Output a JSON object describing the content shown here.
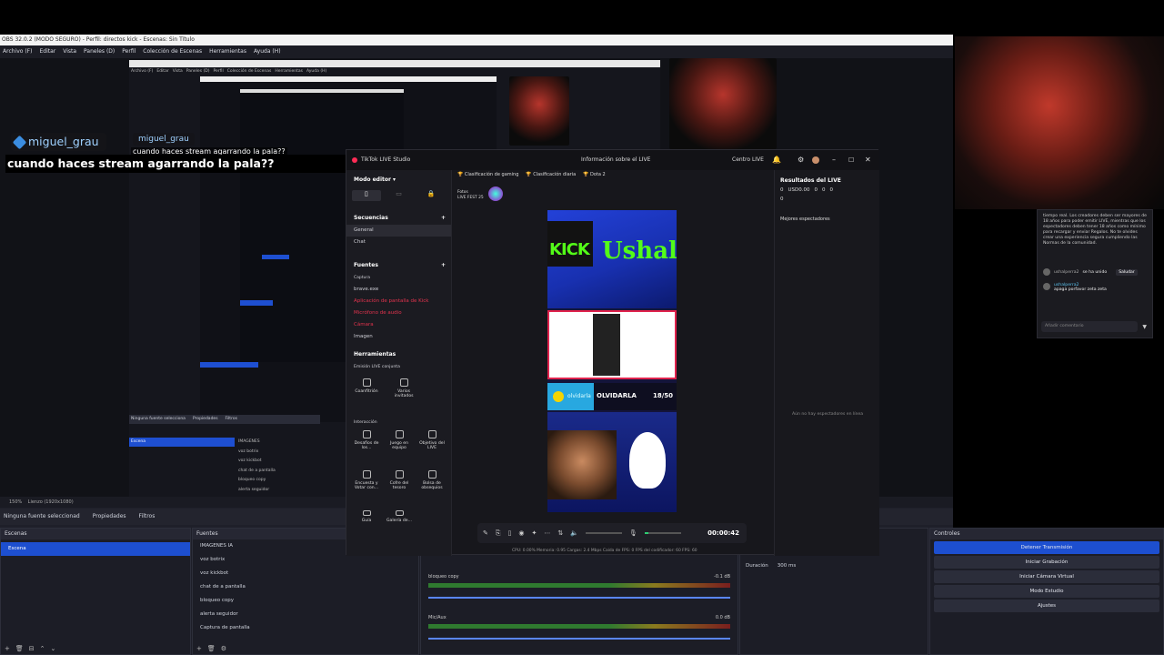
{
  "obs": {
    "title": "OBS 32.0.2 (MODO SEGURO) - Perfil: directos kick - Escenas: Sin Título",
    "menu": [
      "Archivo (F)",
      "Editar",
      "Vista",
      "Paneles (D)",
      "Perfil",
      "Colección de Escenas",
      "Herramientas",
      "Ayuda (H)"
    ],
    "status_left": "150%",
    "status_res": "Lienzo (1920x1080)",
    "no_source": "Ninguna fuente seleccionad",
    "properties": "Propiedades",
    "filters": "Filtros",
    "scenes_header": "Escenas",
    "scenes": [
      "Escena"
    ],
    "sources_header": "Fuentes",
    "sources": [
      "IMAGENES IA",
      "voz botrix",
      "voz kickbot",
      "chat de a pantalla",
      "bloqueo copy",
      "alerta seguidor",
      "Captura de pantalla"
    ],
    "mixer": [
      {
        "name": "bloqueo copy",
        "db": "-0.1 dB"
      },
      {
        "name": "Mic/Aux",
        "db": "0.0 dB"
      }
    ],
    "duration_label": "Duración",
    "duration_value": "300 ms",
    "controls_header": "Controles",
    "controls": [
      "Detener Transmisión",
      "Iniciar Grabación",
      "Iniciar Cámara Virtual",
      "Modo Estudio",
      "Ajustes"
    ],
    "nested_menu": [
      "Archivo (F)",
      "Editar",
      "Vista",
      "Paneles (D)",
      "Perfil",
      "Colección de Escenas",
      "Herramientas",
      "Ayuda (H)"
    ],
    "nested_sources": [
      "IMAGENES",
      "voz botrix",
      "voz kickbot",
      "chat de a pantalla",
      "bloqueo copy",
      "alerta seguidor"
    ],
    "nested_scene": "Escena",
    "nested_props": "Propiedades",
    "nested_filters": "Filtros",
    "nested_none": "Ninguna fuente selecciona"
  },
  "overlay": {
    "username": "miguel_grau",
    "username_small": "miguel_grau",
    "caption": "cuando haces stream agarrando la pala??",
    "caption_small": "cuando haces stream agarrando la pala??"
  },
  "tiktok": {
    "app_title": "TikTok LIVE Studio",
    "info_title": "Información sobre el LIVE",
    "centro": "Centro LIVE",
    "mode": "Modo editor",
    "sequences": "Secuencias",
    "general": "General",
    "chat": "Chat",
    "sources": "Fuentes",
    "source_list": [
      "Captura",
      "brave.exe",
      "Aplicación de pantalla de Kick",
      "Micrófono de audio",
      "Cámara",
      "Imagen"
    ],
    "tools": "Herramientas",
    "joint": "Emisión LIVE conjunta",
    "interaction": "Interacción",
    "tool_items": [
      "Coanfitrión",
      "Varios invitados",
      "Desafíos de los...",
      "Juego en equipo",
      "Objetivo del LIVE",
      "Encuesta y Votar con...",
      "Cofre del tesoro",
      "Bolsa de obsequios",
      "Guía",
      "Galería de..."
    ],
    "tabs": [
      "Clasificación de gaming",
      "Clasificación diaria",
      "Dota 2"
    ],
    "badge_top": "Fotos",
    "badge_bottom": "LIVE FEST 25",
    "results": "Resultados del LIVE",
    "stats": [
      "0",
      "USD0.00",
      "0",
      "0",
      "0",
      "0"
    ],
    "best_viewers": "Mejores espectadores",
    "no_viewers": "Aún no hay espectadores en línea",
    "timer": "00:00:42",
    "status_bar": "CPU: 0.00%   Memoria: 0.95   Cargas: 2.4 Mbps   Caída de FPS: 0   FPS del codificador: 60   FPS: 60"
  },
  "stream_canvas": {
    "kick": "KICK",
    "name": "Ushal",
    "goal_label": "OLVIDARLA",
    "goal_user": "olvidarla",
    "goal_count": "18/50"
  },
  "chat": {
    "notice": "tiempo real. Los creadores deben ser mayores de 18 años para poder emitir LIVE, mientras que los espectadores deben tener 18 años como mínimo para recargar y enviar Regalos. No te olvides crear una experiencia segura cumpliendo las Normas de la comunidad.",
    "msg1_user": "ushalperra2",
    "msg1_text": "se ha unido",
    "msg1_btn": "Saludar",
    "msg2_user": "ushalperra2",
    "msg2_text": "apaga porfavor zeta zeta",
    "input_placeholder": "Añadir comentario"
  },
  "colors": {
    "accent": "#1d4fd0",
    "live_red": "#fe2c55",
    "kick_green": "#53fc18"
  }
}
